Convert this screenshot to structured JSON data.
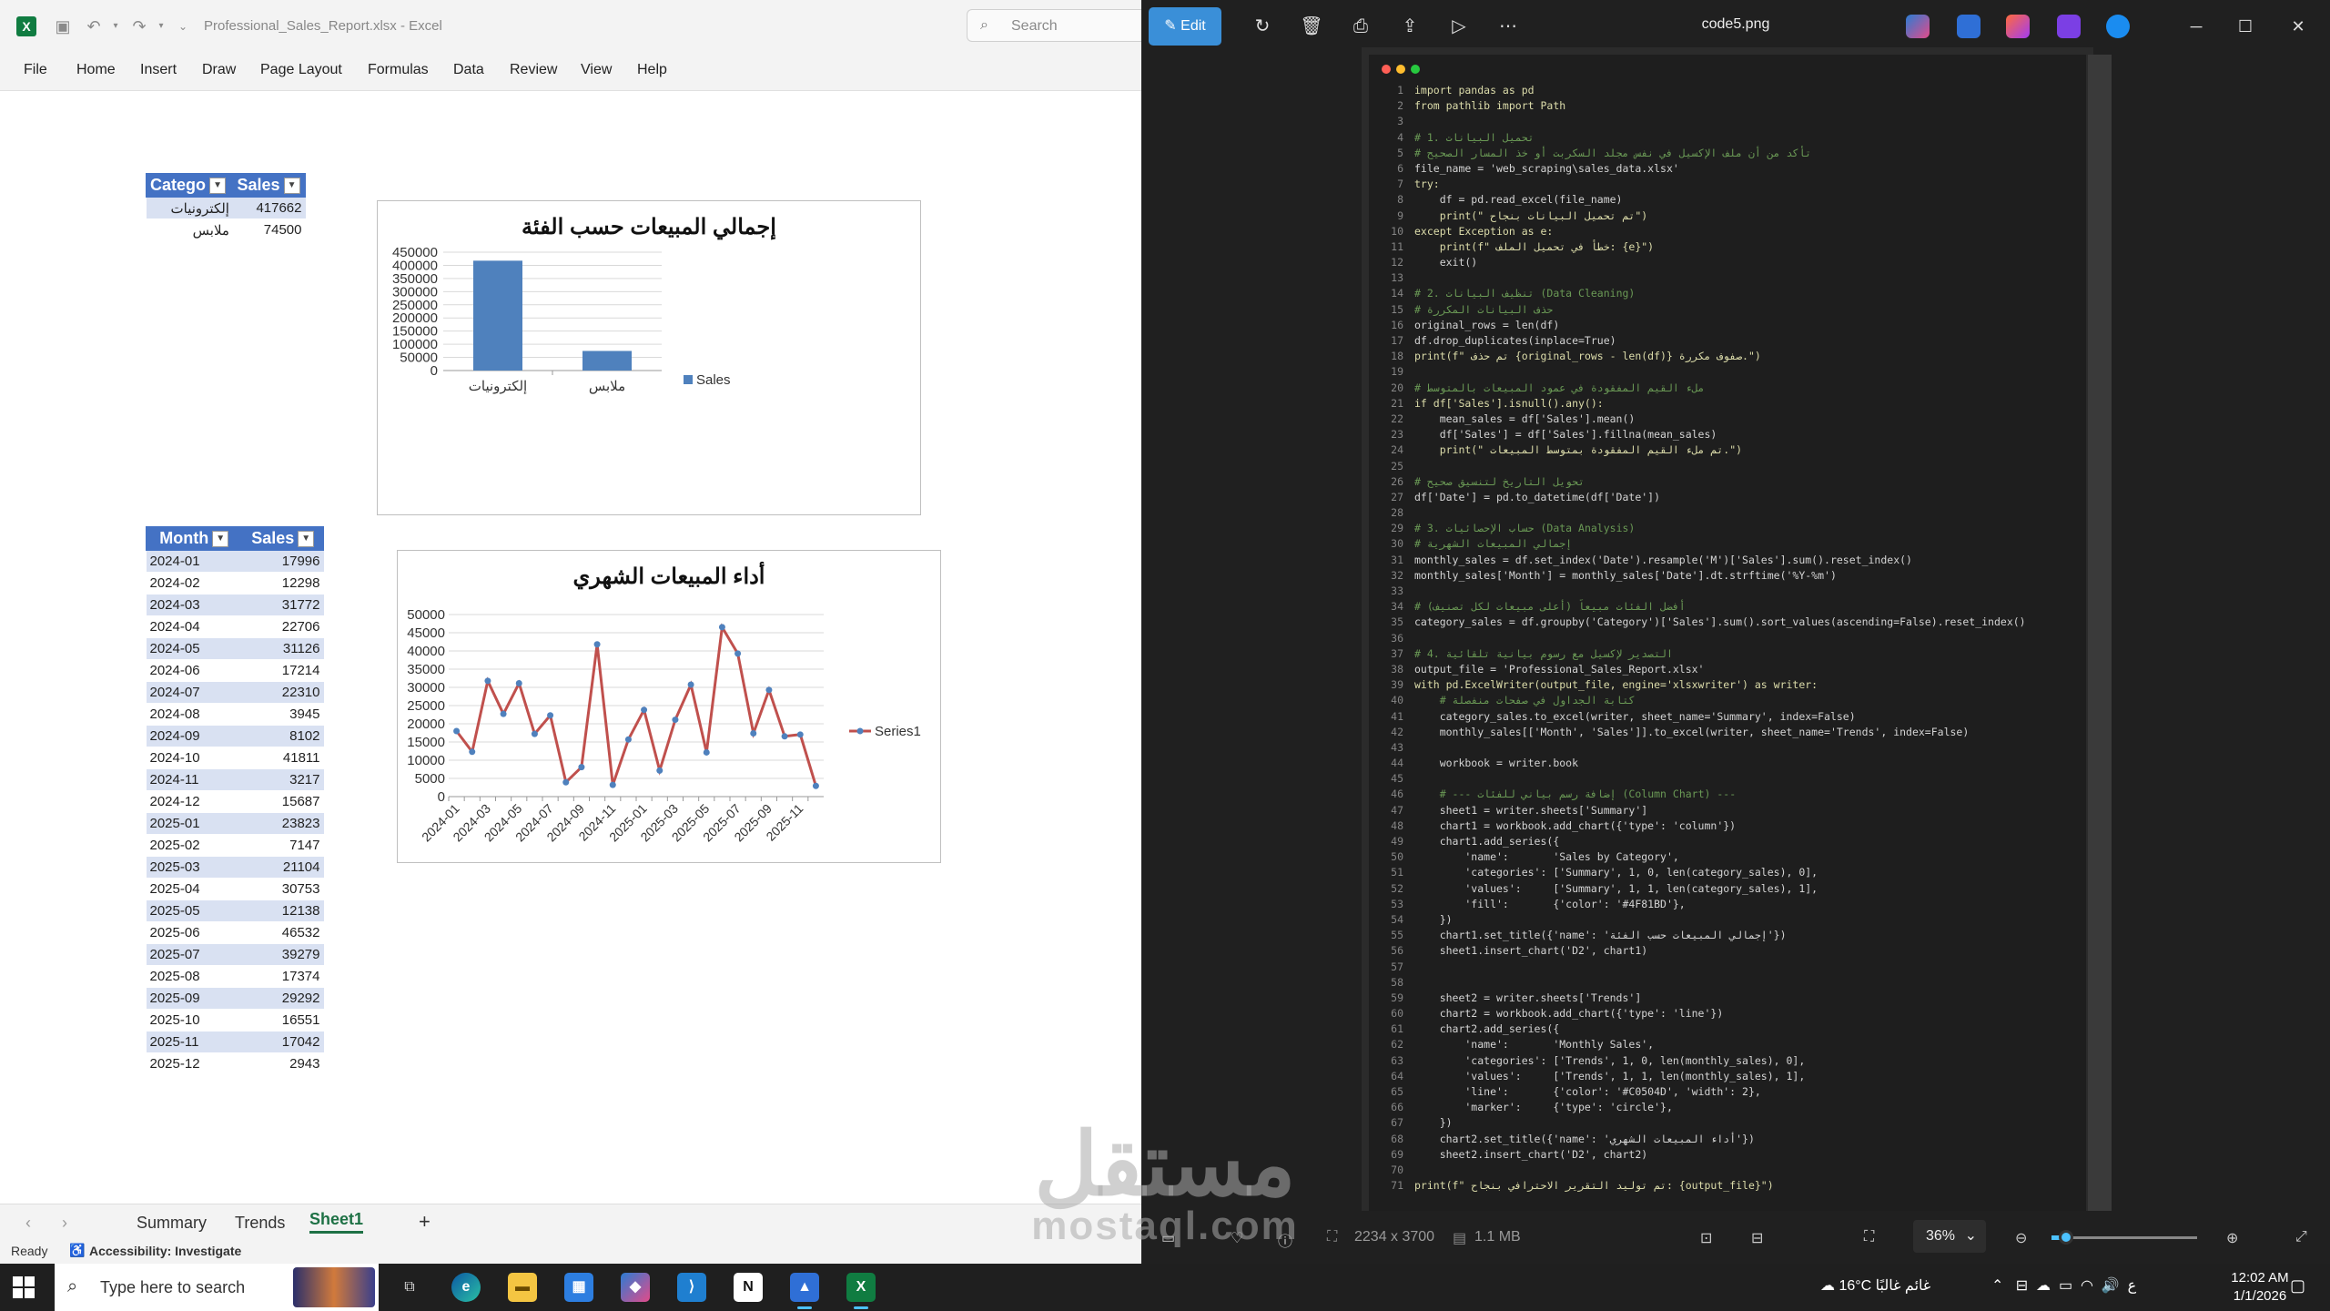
{
  "excel": {
    "title_file": "Professional_Sales_Report.xlsx",
    "title_app": "Excel",
    "search_placeholder": "Search",
    "menu": [
      "File",
      "Home",
      "Insert",
      "Draw",
      "Page Layout",
      "Formulas",
      "Data",
      "Review",
      "View",
      "Help"
    ],
    "table1": {
      "headers": [
        "Catego",
        "Sales"
      ],
      "rows": [
        [
          "إلكترونيات",
          "417662"
        ],
        [
          "ملابس",
          "74500"
        ]
      ]
    },
    "table2": {
      "headers": [
        "Month",
        "Sales"
      ],
      "rows": [
        [
          "2024-01",
          "17996"
        ],
        [
          "2024-02",
          "12298"
        ],
        [
          "2024-03",
          "31772"
        ],
        [
          "2024-04",
          "22706"
        ],
        [
          "2024-05",
          "31126"
        ],
        [
          "2024-06",
          "17214"
        ],
        [
          "2024-07",
          "22310"
        ],
        [
          "2024-08",
          "3945"
        ],
        [
          "2024-09",
          "8102"
        ],
        [
          "2024-10",
          "41811"
        ],
        [
          "2024-11",
          "3217"
        ],
        [
          "2024-12",
          "15687"
        ],
        [
          "2025-01",
          "23823"
        ],
        [
          "2025-02",
          "7147"
        ],
        [
          "2025-03",
          "21104"
        ],
        [
          "2025-04",
          "30753"
        ],
        [
          "2025-05",
          "12138"
        ],
        [
          "2025-06",
          "46532"
        ],
        [
          "2025-07",
          "39279"
        ],
        [
          "2025-08",
          "17374"
        ],
        [
          "2025-09",
          "29292"
        ],
        [
          "2025-10",
          "16551"
        ],
        [
          "2025-11",
          "17042"
        ],
        [
          "2025-12",
          "2943"
        ]
      ]
    },
    "sheet_tabs": [
      "Summary",
      "Trends",
      "Sheet1"
    ],
    "active_sheet": "Sheet1",
    "status_ready": "Ready",
    "status_accessibility": "Accessibility: Investigate"
  },
  "chart_data": [
    {
      "type": "bar",
      "title": "إجمالي المبيعات حسب الفئة",
      "categories": [
        "إلكترونيات",
        "ملابس"
      ],
      "series": [
        {
          "name": "Sales",
          "values": [
            417662,
            74500
          ],
          "color": "#4F81BD"
        }
      ],
      "ylim": [
        0,
        450000
      ],
      "yticks": [
        "0",
        "50000",
        "100000",
        "150000",
        "200000",
        "250000",
        "300000",
        "350000",
        "400000",
        "450000"
      ],
      "legend": "right",
      "grid": true
    },
    {
      "type": "line",
      "title": "أداء المبيعات الشهري",
      "categories": [
        "2024-01",
        "2024-02",
        "2024-03",
        "2024-04",
        "2024-05",
        "2024-06",
        "2024-07",
        "2024-08",
        "2024-09",
        "2024-10",
        "2024-11",
        "2024-12",
        "2025-01",
        "2025-02",
        "2025-03",
        "2025-04",
        "2025-05",
        "2025-06",
        "2025-07",
        "2025-08",
        "2025-09",
        "2025-10",
        "2025-11",
        "2025-12"
      ],
      "xtick_labels": [
        "2024-01",
        "2024-03",
        "2024-05",
        "2024-07",
        "2024-09",
        "2024-11",
        "2025-01",
        "2025-03",
        "2025-05",
        "2025-07",
        "2025-09",
        "2025-11"
      ],
      "series": [
        {
          "name": "Series1",
          "values": [
            17996,
            12298,
            31772,
            22706,
            31126,
            17214,
            22310,
            3945,
            8102,
            41811,
            3217,
            15687,
            23823,
            7147,
            21104,
            30753,
            12138,
            46532,
            39279,
            17374,
            29292,
            16551,
            17042,
            2943
          ],
          "color": "#C0504D"
        }
      ],
      "ylim": [
        0,
        50000
      ],
      "yticks": [
        "0",
        "5000",
        "10000",
        "15000",
        "20000",
        "25000",
        "30000",
        "35000",
        "40000",
        "45000",
        "50000"
      ],
      "legend": "right",
      "grid": true
    }
  ],
  "viewer": {
    "edit_label": "Edit",
    "file_name": "code5.png",
    "code_lines": [
      "import pandas as pd",
      "from pathlib import Path",
      "",
      "# 1. تحميل البيانات",
      "# تأكد من أن ملف الإكسيل في نفس مجلد السكربت أو خذ المسار الصحيح",
      "file_name = 'web_scraping\\sales_data.xlsx'",
      "try:",
      "    df = pd.read_excel(file_name)",
      "    print(\" تم تحميل البيانات بنجاح\")",
      "except Exception as e:",
      "    print(f\" خطأ في تحميل الملف: {e}\")",
      "    exit()",
      "",
      "# 2. تنظيف البيانات (Data Cleaning)",
      "# حذف البيانات المكررة",
      "original_rows = len(df)",
      "df.drop_duplicates(inplace=True)",
      "print(f\" تم حذف {original_rows - len(df)} صفوف مكررة.\")",
      "",
      "# ملء القيم المفقودة في عمود المبيعات بالمتوسط",
      "if df['Sales'].isnull().any():",
      "    mean_sales = df['Sales'].mean()",
      "    df['Sales'] = df['Sales'].fillna(mean_sales)",
      "    print(\" تم ملء القيم المفقودة بمتوسط المبيعات.\")",
      "",
      "# تحويل التاريخ لتنسيق صحيح",
      "df['Date'] = pd.to_datetime(df['Date'])",
      "",
      "# 3. حساب الإحصائيات (Data Analysis)",
      "# إجمالي المبيعات الشهرية",
      "monthly_sales = df.set_index('Date').resample('M')['Sales'].sum().reset_index()",
      "monthly_sales['Month'] = monthly_sales['Date'].dt.strftime('%Y-%m')",
      "",
      "# أفضل الفئات مبيعاً (أعلى مبيعات لكل تصنيف)",
      "category_sales = df.groupby('Category')['Sales'].sum().sort_values(ascending=False).reset_index()",
      "",
      "# 4. التصدير لإكسيل مع رسوم بيانية تلقائية",
      "output_file = 'Professional_Sales_Report.xlsx'",
      "with pd.ExcelWriter(output_file, engine='xlsxwriter') as writer:",
      "    # كتابة الجداول في صفحات منفصلة",
      "    category_sales.to_excel(writer, sheet_name='Summary', index=False)",
      "    monthly_sales[['Month', 'Sales']].to_excel(writer, sheet_name='Trends', index=False)",
      "",
      "    workbook = writer.book",
      "",
      "    # --- إضافة رسم بياني للفئات (Column Chart) ---",
      "    sheet1 = writer.sheets['Summary']",
      "    chart1 = workbook.add_chart({'type': 'column'})",
      "    chart1.add_series({",
      "        'name':       'Sales by Category',",
      "        'categories': ['Summary', 1, 0, len(category_sales), 0],",
      "        'values':     ['Summary', 1, 1, len(category_sales), 1],",
      "        'fill':       {'color': '#4F81BD'},",
      "    })",
      "    chart1.set_title({'name': 'إجمالي المبيعات حسب الفئة'})",
      "    sheet1.insert_chart('D2', chart1)",
      "",
      "",
      "    sheet2 = writer.sheets['Trends']",
      "    chart2 = workbook.add_chart({'type': 'line'})",
      "    chart2.add_series({",
      "        'name':       'Monthly Sales',",
      "        'categories': ['Trends', 1, 0, len(monthly_sales), 0],",
      "        'values':     ['Trends', 1, 1, len(monthly_sales), 1],",
      "        'line':       {'color': '#C0504D', 'width': 2},",
      "        'marker':     {'type': 'circle'},",
      "    })",
      "    chart2.set_title({'name': 'أداء المبيعات الشهري'})",
      "    sheet2.insert_chart('D2', chart2)",
      "",
      "print(f\" تم توليد التقرير الاحترافي بنجاح: {output_file}\")"
    ],
    "dimensions": "2234 x 3700",
    "file_size": "1.1 MB",
    "zoom": "36%"
  },
  "watermark": {
    "arabic": "مستقل",
    "latin": "mostaql.com"
  },
  "taskbar": {
    "search_placeholder": "Type here to search",
    "weather_temp": "16°C",
    "weather_text": "غائم غالبًا",
    "time": "12:02 AM",
    "date": "1/1/2026"
  }
}
